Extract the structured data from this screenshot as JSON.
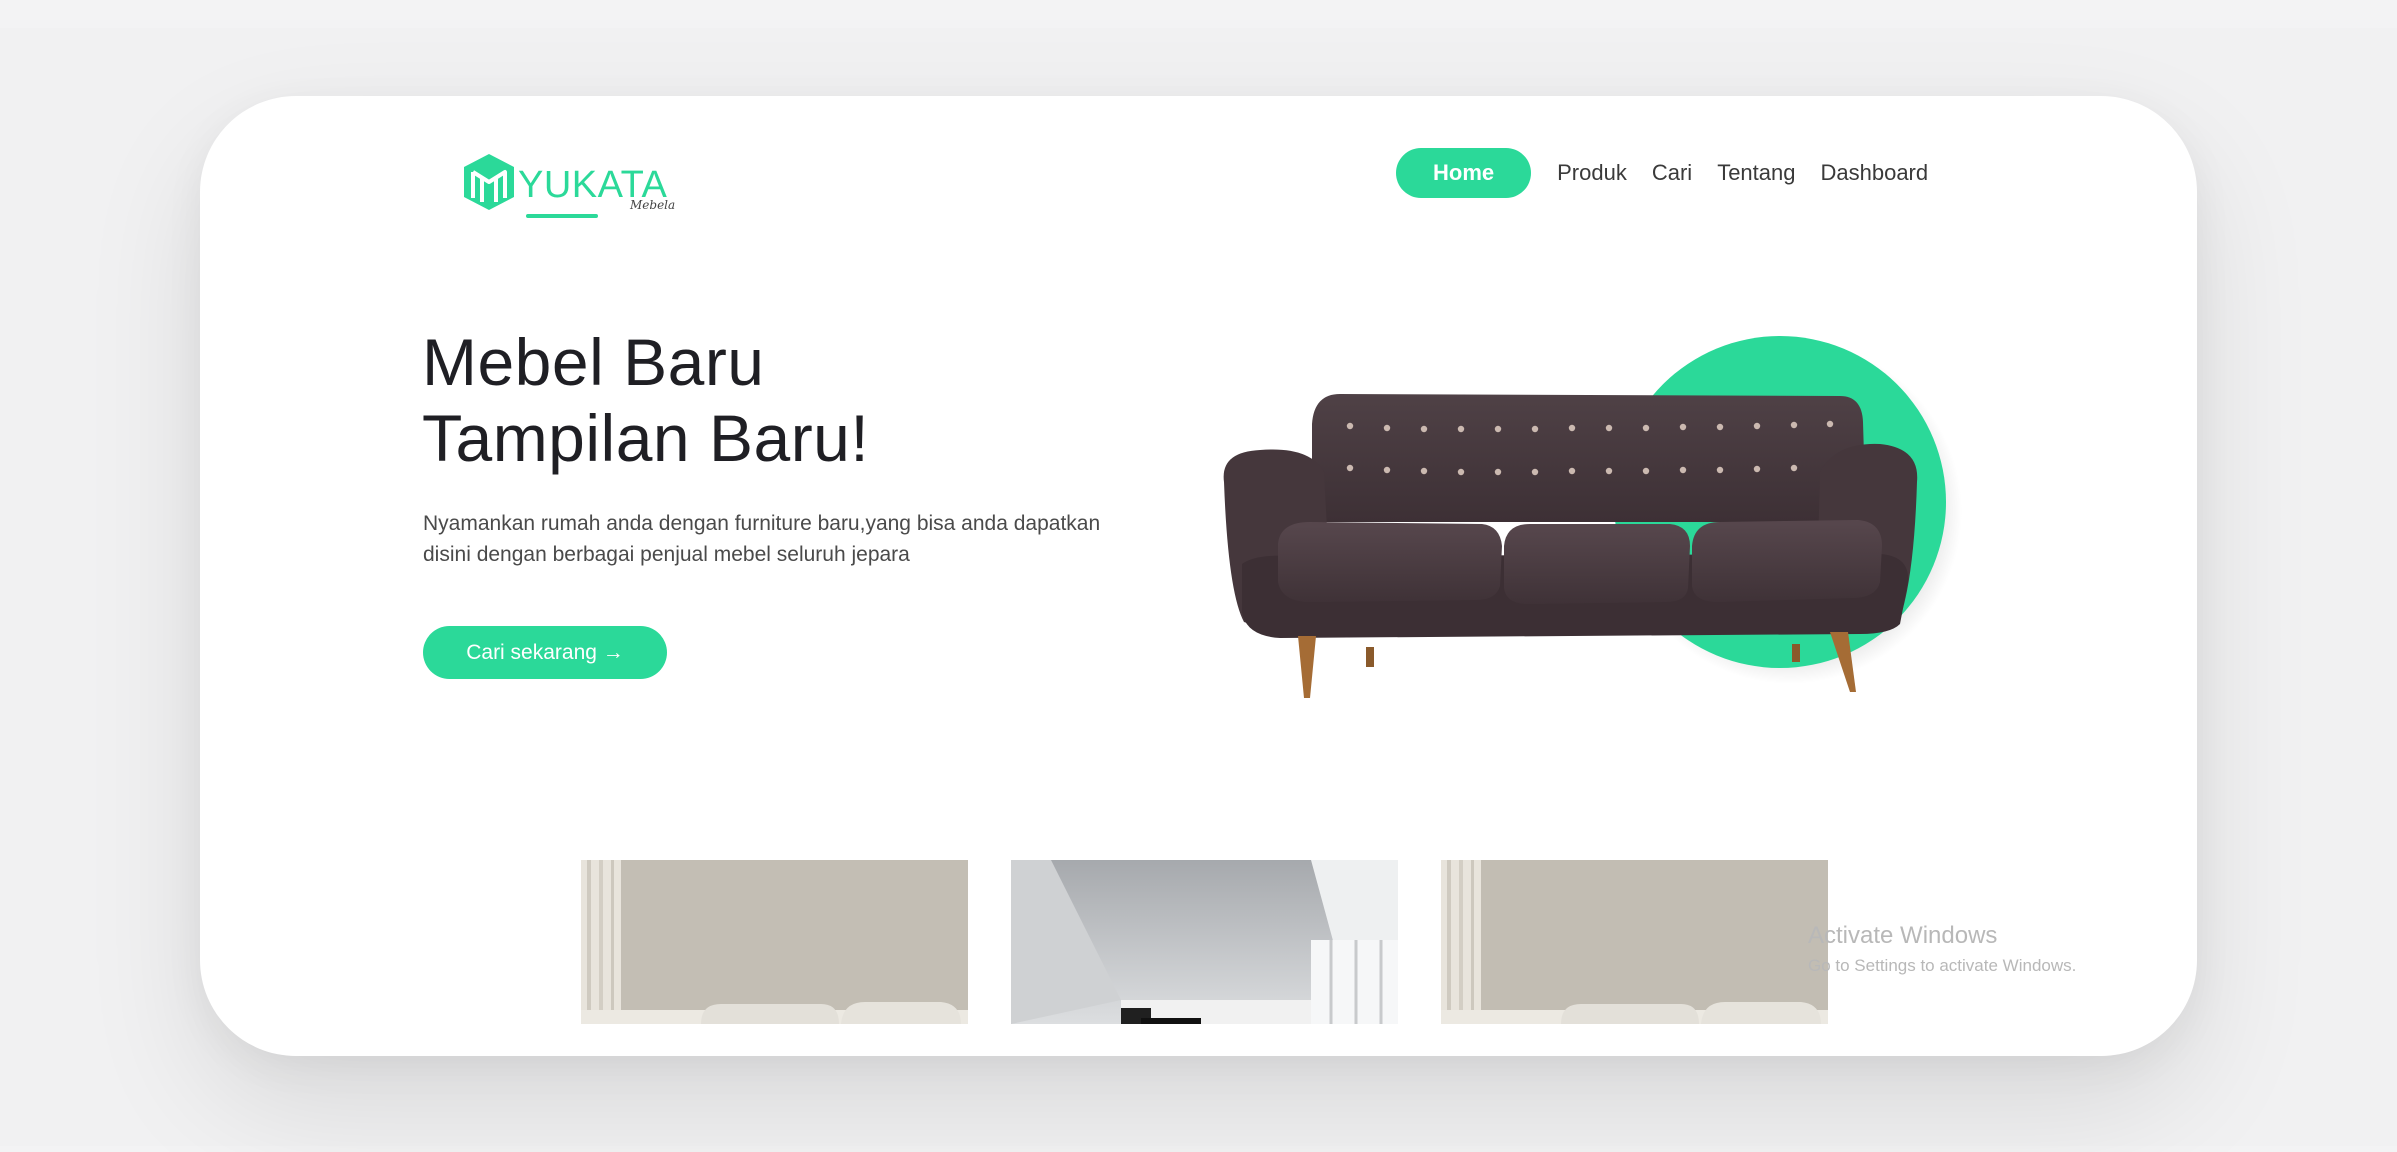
{
  "brand": {
    "name": "YUKATA",
    "tagline": "Mebela"
  },
  "nav": {
    "items": [
      {
        "label": "Home",
        "active": true
      },
      {
        "label": "Produk",
        "active": false
      },
      {
        "label": "Cari",
        "active": false
      },
      {
        "label": "Tentang",
        "active": false
      },
      {
        "label": "Dashboard",
        "active": false
      }
    ]
  },
  "hero": {
    "title_line1": "Mebel Baru",
    "title_line2": "Tampilan Baru!",
    "description_line1": "Nyamankan rumah anda dengan furniture baru,yang bisa anda dapatkan",
    "description_line2": "disini dengan berbagai penjual mebel seluruh jepara",
    "cta_label": "Cari sekarang →",
    "image_icon": "sofa-image"
  },
  "colors": {
    "accent": "#2bd999",
    "text_dark": "#1f1f24",
    "sofa": "#4a3b40"
  },
  "windows_watermark": {
    "title": "Activate Windows",
    "subtitle": "Go to Settings to activate Windows."
  }
}
